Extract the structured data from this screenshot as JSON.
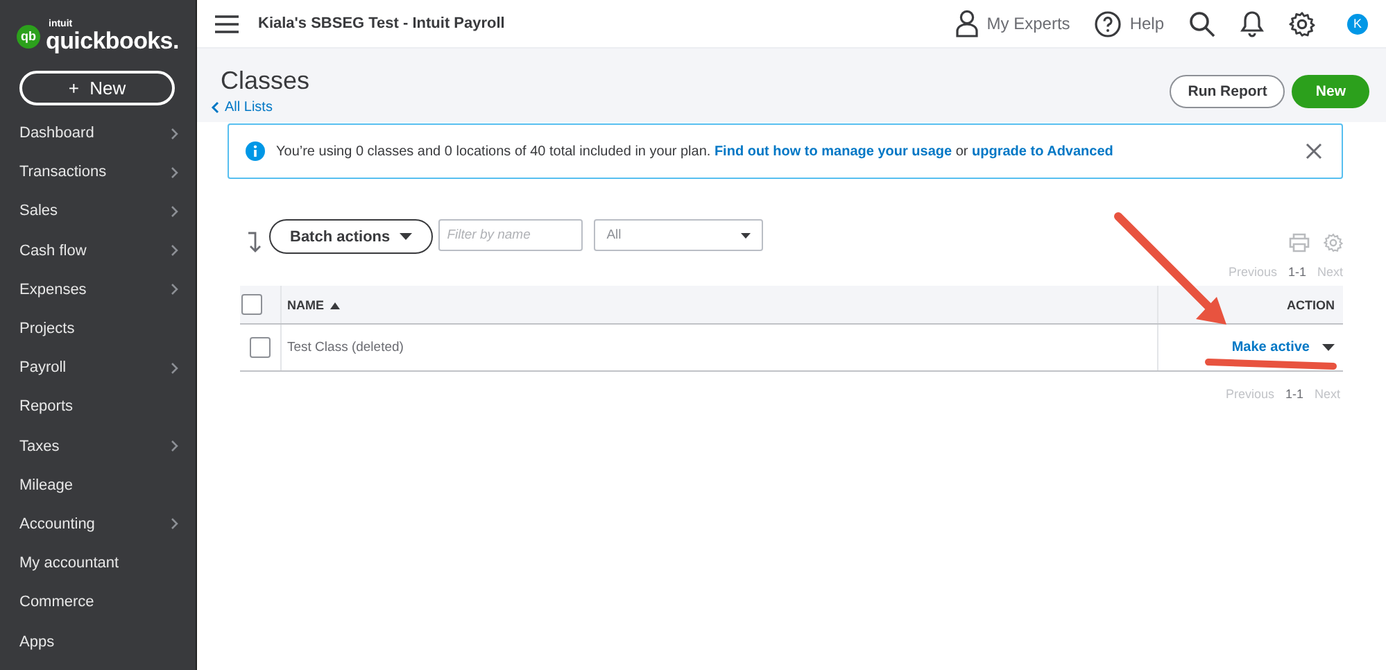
{
  "logo": {
    "mark": "qb",
    "brand": "intuit",
    "name": "quickbooks."
  },
  "new_button": {
    "icon": "+",
    "label": "New"
  },
  "sidebar": {
    "items": [
      {
        "label": "Dashboard",
        "submenu": true
      },
      {
        "label": "Transactions",
        "submenu": true
      },
      {
        "label": "Sales",
        "submenu": true
      },
      {
        "label": "Cash flow",
        "submenu": true
      },
      {
        "label": "Expenses",
        "submenu": true
      },
      {
        "label": "Projects",
        "submenu": false
      },
      {
        "label": "Payroll",
        "submenu": true
      },
      {
        "label": "Reports",
        "submenu": false
      },
      {
        "label": "Taxes",
        "submenu": true
      },
      {
        "label": "Mileage",
        "submenu": false
      },
      {
        "label": "Accounting",
        "submenu": true
      },
      {
        "label": "My accountant",
        "submenu": false
      },
      {
        "label": "Commerce",
        "submenu": false
      },
      {
        "label": "Apps",
        "submenu": false
      }
    ]
  },
  "topbar": {
    "company": "Kiala's SBSEG Test - Intuit Payroll",
    "experts": "My Experts",
    "help": "Help",
    "avatar": "K"
  },
  "page": {
    "title": "Classes",
    "back_link": "All Lists",
    "run_report": "Run Report",
    "new": "New"
  },
  "banner": {
    "text": "You’re using 0 classes and 0 locations of 40 total included in your plan.",
    "link": "Find out how to manage your usage",
    "joiner": "or",
    "link2": "upgrade to Advanced"
  },
  "toolbar": {
    "batch_actions": "Batch actions",
    "filter_placeholder": "Filter by name",
    "status_filter": "All"
  },
  "pager_top": {
    "previous": "Previous",
    "range": "1-1",
    "next": "Next"
  },
  "table": {
    "header_checked": false,
    "columns": [
      {
        "label": "NAME",
        "sorted": true
      },
      {
        "label": "ACTION",
        "sorted": false
      }
    ],
    "rows": [
      {
        "checked": false,
        "name": "Test Class (deleted)",
        "action": "Make active"
      }
    ]
  },
  "pager_bottom": {
    "previous": "Previous",
    "range": "1-1",
    "next": "Next"
  }
}
